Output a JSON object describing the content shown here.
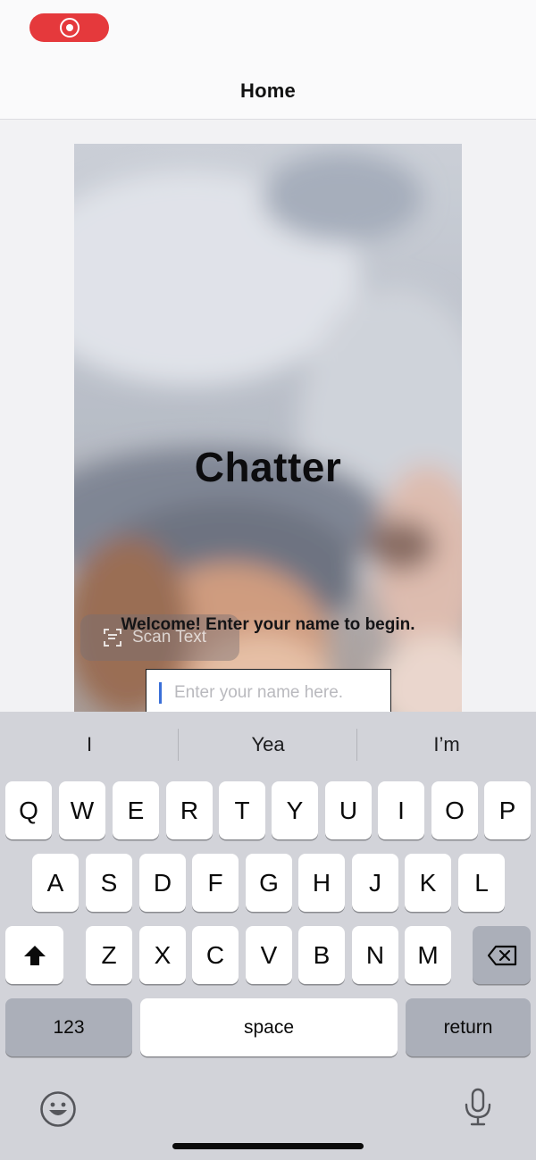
{
  "status_bar": {
    "record_icon": "record-icon"
  },
  "nav": {
    "title": "Home"
  },
  "hero": {
    "app_title": "Chatter",
    "welcome_text": "Welcome! Enter your name to begin.",
    "scan_text_label": "Scan Text",
    "scan_icon": "scan-text-icon",
    "name_field": {
      "value": "",
      "placeholder": "Enter your name here."
    }
  },
  "keyboard": {
    "suggestions": [
      "I",
      "Yea",
      "I’m"
    ],
    "row1": [
      "Q",
      "W",
      "E",
      "R",
      "T",
      "Y",
      "U",
      "I",
      "O",
      "P"
    ],
    "row2": [
      "A",
      "S",
      "D",
      "F",
      "G",
      "H",
      "J",
      "K",
      "L"
    ],
    "row3": [
      "Z",
      "X",
      "C",
      "V",
      "B",
      "N",
      "M"
    ],
    "shift_icon": "shift-icon",
    "delete_icon": "delete-icon",
    "numbers_label": "123",
    "space_label": "space",
    "return_label": "return",
    "emoji_icon": "emoji-icon",
    "mic_icon": "microphone-icon"
  },
  "colors": {
    "record_red": "#e5393c",
    "caret_blue": "#3a6fd8",
    "keyboard_bg": "#d2d3d9"
  }
}
